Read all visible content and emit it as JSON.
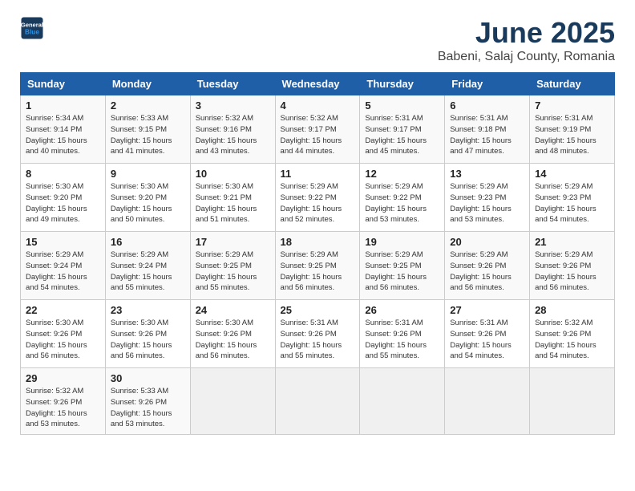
{
  "header": {
    "logo_line1": "General",
    "logo_line2": "Blue",
    "title": "June 2025",
    "subtitle": "Babeni, Salaj County, Romania"
  },
  "weekdays": [
    "Sunday",
    "Monday",
    "Tuesday",
    "Wednesday",
    "Thursday",
    "Friday",
    "Saturday"
  ],
  "weeks": [
    [
      {
        "day": "1",
        "sunrise": "Sunrise: 5:34 AM",
        "sunset": "Sunset: 9:14 PM",
        "daylight": "Daylight: 15 hours and 40 minutes."
      },
      {
        "day": "2",
        "sunrise": "Sunrise: 5:33 AM",
        "sunset": "Sunset: 9:15 PM",
        "daylight": "Daylight: 15 hours and 41 minutes."
      },
      {
        "day": "3",
        "sunrise": "Sunrise: 5:32 AM",
        "sunset": "Sunset: 9:16 PM",
        "daylight": "Daylight: 15 hours and 43 minutes."
      },
      {
        "day": "4",
        "sunrise": "Sunrise: 5:32 AM",
        "sunset": "Sunset: 9:17 PM",
        "daylight": "Daylight: 15 hours and 44 minutes."
      },
      {
        "day": "5",
        "sunrise": "Sunrise: 5:31 AM",
        "sunset": "Sunset: 9:17 PM",
        "daylight": "Daylight: 15 hours and 45 minutes."
      },
      {
        "day": "6",
        "sunrise": "Sunrise: 5:31 AM",
        "sunset": "Sunset: 9:18 PM",
        "daylight": "Daylight: 15 hours and 47 minutes."
      },
      {
        "day": "7",
        "sunrise": "Sunrise: 5:31 AM",
        "sunset": "Sunset: 9:19 PM",
        "daylight": "Daylight: 15 hours and 48 minutes."
      }
    ],
    [
      {
        "day": "8",
        "sunrise": "Sunrise: 5:30 AM",
        "sunset": "Sunset: 9:20 PM",
        "daylight": "Daylight: 15 hours and 49 minutes."
      },
      {
        "day": "9",
        "sunrise": "Sunrise: 5:30 AM",
        "sunset": "Sunset: 9:20 PM",
        "daylight": "Daylight: 15 hours and 50 minutes."
      },
      {
        "day": "10",
        "sunrise": "Sunrise: 5:30 AM",
        "sunset": "Sunset: 9:21 PM",
        "daylight": "Daylight: 15 hours and 51 minutes."
      },
      {
        "day": "11",
        "sunrise": "Sunrise: 5:29 AM",
        "sunset": "Sunset: 9:22 PM",
        "daylight": "Daylight: 15 hours and 52 minutes."
      },
      {
        "day": "12",
        "sunrise": "Sunrise: 5:29 AM",
        "sunset": "Sunset: 9:22 PM",
        "daylight": "Daylight: 15 hours and 53 minutes."
      },
      {
        "day": "13",
        "sunrise": "Sunrise: 5:29 AM",
        "sunset": "Sunset: 9:23 PM",
        "daylight": "Daylight: 15 hours and 53 minutes."
      },
      {
        "day": "14",
        "sunrise": "Sunrise: 5:29 AM",
        "sunset": "Sunset: 9:23 PM",
        "daylight": "Daylight: 15 hours and 54 minutes."
      }
    ],
    [
      {
        "day": "15",
        "sunrise": "Sunrise: 5:29 AM",
        "sunset": "Sunset: 9:24 PM",
        "daylight": "Daylight: 15 hours and 54 minutes."
      },
      {
        "day": "16",
        "sunrise": "Sunrise: 5:29 AM",
        "sunset": "Sunset: 9:24 PM",
        "daylight": "Daylight: 15 hours and 55 minutes."
      },
      {
        "day": "17",
        "sunrise": "Sunrise: 5:29 AM",
        "sunset": "Sunset: 9:25 PM",
        "daylight": "Daylight: 15 hours and 55 minutes."
      },
      {
        "day": "18",
        "sunrise": "Sunrise: 5:29 AM",
        "sunset": "Sunset: 9:25 PM",
        "daylight": "Daylight: 15 hours and 56 minutes."
      },
      {
        "day": "19",
        "sunrise": "Sunrise: 5:29 AM",
        "sunset": "Sunset: 9:25 PM",
        "daylight": "Daylight: 15 hours and 56 minutes."
      },
      {
        "day": "20",
        "sunrise": "Sunrise: 5:29 AM",
        "sunset": "Sunset: 9:26 PM",
        "daylight": "Daylight: 15 hours and 56 minutes."
      },
      {
        "day": "21",
        "sunrise": "Sunrise: 5:29 AM",
        "sunset": "Sunset: 9:26 PM",
        "daylight": "Daylight: 15 hours and 56 minutes."
      }
    ],
    [
      {
        "day": "22",
        "sunrise": "Sunrise: 5:30 AM",
        "sunset": "Sunset: 9:26 PM",
        "daylight": "Daylight: 15 hours and 56 minutes."
      },
      {
        "day": "23",
        "sunrise": "Sunrise: 5:30 AM",
        "sunset": "Sunset: 9:26 PM",
        "daylight": "Daylight: 15 hours and 56 minutes."
      },
      {
        "day": "24",
        "sunrise": "Sunrise: 5:30 AM",
        "sunset": "Sunset: 9:26 PM",
        "daylight": "Daylight: 15 hours and 56 minutes."
      },
      {
        "day": "25",
        "sunrise": "Sunrise: 5:31 AM",
        "sunset": "Sunset: 9:26 PM",
        "daylight": "Daylight: 15 hours and 55 minutes."
      },
      {
        "day": "26",
        "sunrise": "Sunrise: 5:31 AM",
        "sunset": "Sunset: 9:26 PM",
        "daylight": "Daylight: 15 hours and 55 minutes."
      },
      {
        "day": "27",
        "sunrise": "Sunrise: 5:31 AM",
        "sunset": "Sunset: 9:26 PM",
        "daylight": "Daylight: 15 hours and 54 minutes."
      },
      {
        "day": "28",
        "sunrise": "Sunrise: 5:32 AM",
        "sunset": "Sunset: 9:26 PM",
        "daylight": "Daylight: 15 hours and 54 minutes."
      }
    ],
    [
      {
        "day": "29",
        "sunrise": "Sunrise: 5:32 AM",
        "sunset": "Sunset: 9:26 PM",
        "daylight": "Daylight: 15 hours and 53 minutes."
      },
      {
        "day": "30",
        "sunrise": "Sunrise: 5:33 AM",
        "sunset": "Sunset: 9:26 PM",
        "daylight": "Daylight: 15 hours and 53 minutes."
      },
      null,
      null,
      null,
      null,
      null
    ]
  ]
}
